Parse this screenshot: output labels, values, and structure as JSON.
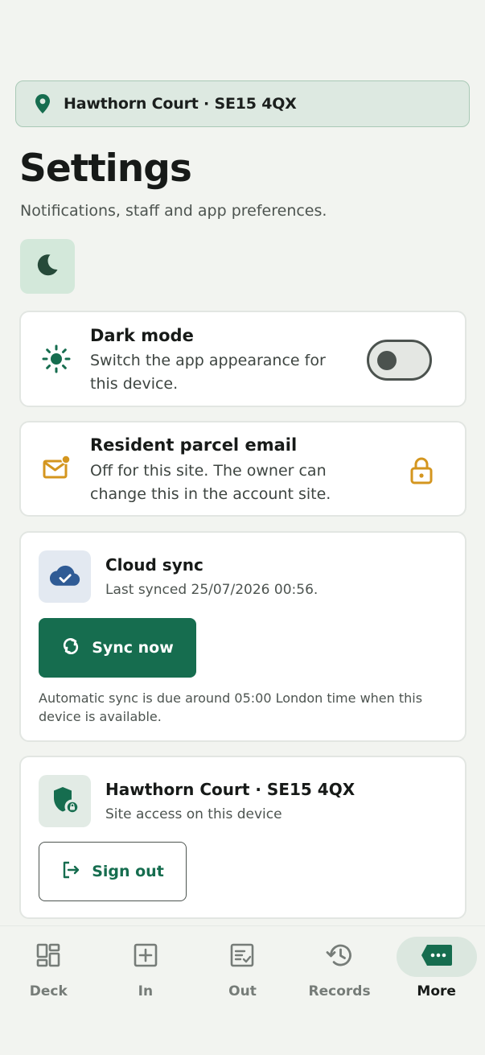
{
  "site": {
    "name": "Hawthorn Court · SE15 4QX"
  },
  "header": {
    "title": "Settings",
    "subtitle": "Notifications, staff and app preferences."
  },
  "dark_mode": {
    "title": "Dark mode",
    "description": "Switch the app appearance for this device.",
    "enabled": false
  },
  "parcel_email": {
    "title": "Resident parcel email",
    "description": "Off for this site. The owner can change this in the account site."
  },
  "cloud_sync": {
    "title": "Cloud sync",
    "last_synced": "Last synced 25/07/2026 00:56.",
    "button_label": "Sync now",
    "note": "Automatic sync is due around 05:00 London time when this device is available."
  },
  "site_access": {
    "title": "Hawthorn Court · SE15 4QX",
    "subtitle": "Site access on this device",
    "sign_out_label": "Sign out"
  },
  "nav": {
    "items": [
      {
        "label": "Deck",
        "icon": "dashboard-icon"
      },
      {
        "label": "In",
        "icon": "add-box-icon"
      },
      {
        "label": "Out",
        "icon": "checklist-icon"
      },
      {
        "label": "Records",
        "icon": "history-icon"
      },
      {
        "label": "More",
        "icon": "more-icon",
        "active": true
      }
    ]
  },
  "colors": {
    "primary": "#166d4f",
    "accent_amber": "#d4961f",
    "sync_blue": "#2f5b95",
    "background": "#f2f4f0"
  }
}
